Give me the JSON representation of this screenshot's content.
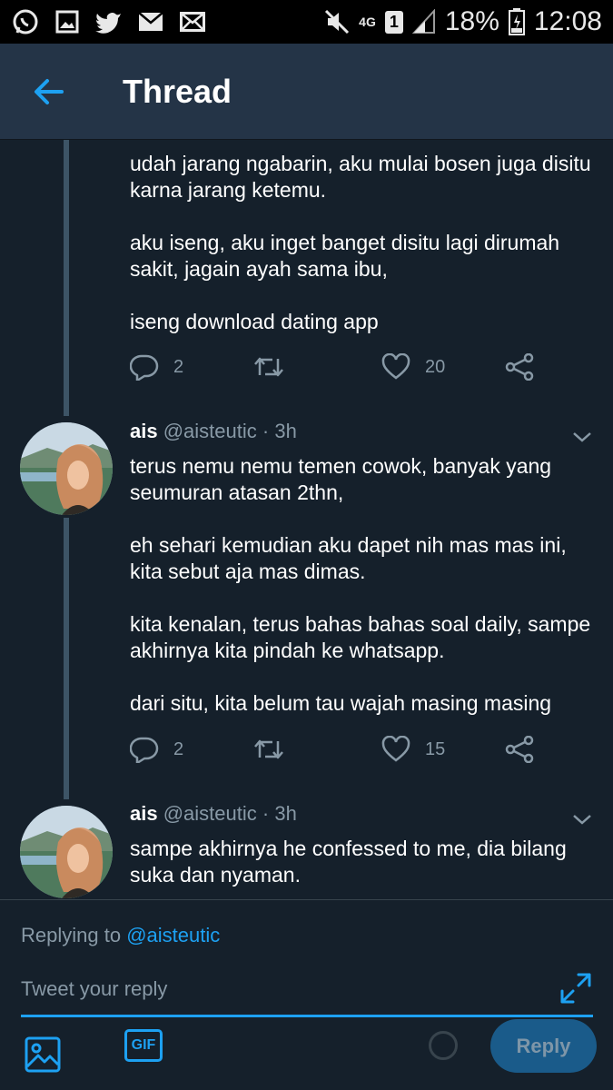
{
  "status_bar": {
    "left_icons": [
      "whatsapp-icon",
      "gallery-icon",
      "twitter-icon",
      "mail-icon",
      "message-icon"
    ],
    "network": "4G",
    "sim": "1",
    "battery": "18%",
    "time": "12:08"
  },
  "header": {
    "title": "Thread"
  },
  "tweets": [
    {
      "text": "udah jarang ngabarin, aku mulai bosen juga disitu karna jarang ketemu.\n\naku iseng, aku inget banget disitu lagi dirumah sakit, jagain ayah sama ibu,\n\niseng download dating app",
      "replies": "2",
      "likes": "20"
    },
    {
      "name": "ais",
      "handle": "@aisteutic",
      "dot": "·",
      "time": "3h",
      "text": "terus nemu nemu temen cowok, banyak yang seumuran atasan 2thn,\n\neh sehari kemudian aku dapet nih mas mas ini, kita sebut aja mas dimas.\n\nkita kenalan, terus bahas bahas soal daily, sampe akhirnya kita pindah ke whatsapp.\n\ndari situ, kita belum tau wajah masing masing",
      "replies": "2",
      "likes": "15"
    },
    {
      "name": "ais",
      "handle": "@aisteutic",
      "dot": "·",
      "time": "3h",
      "text": "sampe akhirnya he confessed to me, dia bilang suka dan nyaman."
    }
  ],
  "composer": {
    "replying_prefix": "Replying to",
    "replying_to": "@aisteutic",
    "placeholder": "Tweet your reply",
    "gif_label": "GIF",
    "reply_button": "Reply"
  },
  "colors": {
    "background": "#15202b",
    "header": "#243447",
    "accent": "#1da1f2",
    "muted": "#8899a6"
  }
}
